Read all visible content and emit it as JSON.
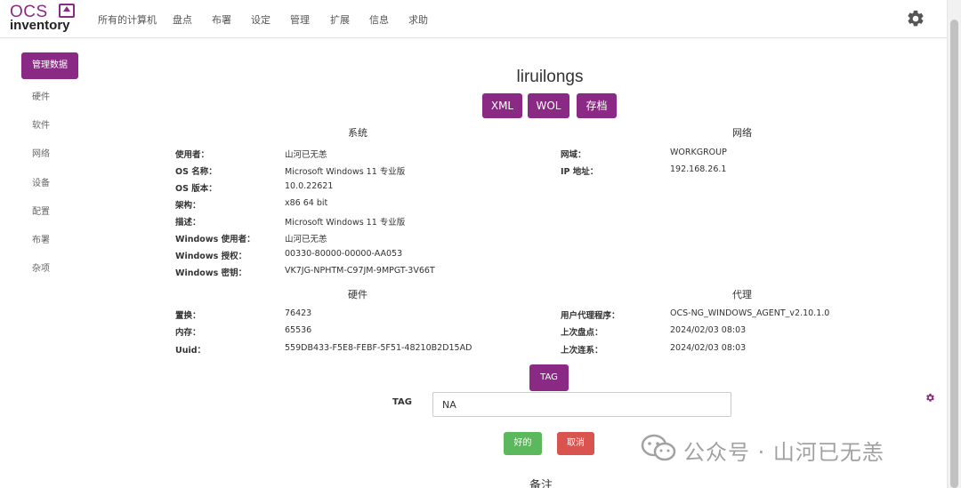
{
  "logo": {
    "top": "OCS",
    "bottom": "inventory"
  },
  "nav": [
    "所有的计算机",
    "盘点",
    "布署",
    "设定",
    "管理",
    "扩展",
    "信息",
    "求助"
  ],
  "icons": {
    "settings": "gear-icon",
    "tag_settings": "gear-icon",
    "watermark": "wechat-icon"
  },
  "sidebar": {
    "active": "管理数据",
    "items": [
      "硬件",
      "软件",
      "网络",
      "设备",
      "配置",
      "布署",
      "杂项"
    ]
  },
  "computer": {
    "name": "liruilongs"
  },
  "actions": {
    "xml": "XML",
    "wol": "WOL",
    "archive": "存档"
  },
  "system": {
    "title": "系统",
    "rows": [
      {
        "label": "使用者：",
        "value": "山河已无恙"
      },
      {
        "label": "OS 名称：",
        "value": "Microsoft Windows 11 专业版"
      },
      {
        "label": "OS 版本：",
        "value": "10.0.22621"
      },
      {
        "label": "架构：",
        "value": "x86 64 bit"
      },
      {
        "label": "描述：",
        "value": "Microsoft Windows 11 专业版"
      },
      {
        "label": "Windows 使用者：",
        "value": "山河已无恙"
      },
      {
        "label": "Windows 授权：",
        "value": "00330-80000-00000-AA053"
      },
      {
        "label": "Windows 密钥：",
        "value": "VK7JG-NPHTM-C97JM-9MPGT-3V66T"
      }
    ]
  },
  "network": {
    "title": "网络",
    "rows": [
      {
        "label": "网域：",
        "value": "WORKGROUP"
      },
      {
        "label": "IP 地址：",
        "value": "192.168.26.1"
      }
    ]
  },
  "hardware": {
    "title": "硬件",
    "rows": [
      {
        "label": "置换：",
        "value": "76423"
      },
      {
        "label": "内存：",
        "value": "65536"
      },
      {
        "label": "Uuid：",
        "value": "559DB433-F5E8-FEBF-5F51-48210B2D15AD"
      }
    ]
  },
  "agent": {
    "title": "代理",
    "rows": [
      {
        "label": "用户代理程序：",
        "value": "OCS-NG_WINDOWS_AGENT_v2.10.1.0"
      },
      {
        "label": "上次盘点：",
        "value": "2024/02/03 08:03"
      },
      {
        "label": "上次连系：",
        "value": "2024/02/03 08:03"
      }
    ]
  },
  "tag": {
    "button": "TAG",
    "label": "TAG",
    "value": "NA"
  },
  "form": {
    "ok": "好的",
    "cancel": "取消"
  },
  "notes": {
    "title": "备注"
  },
  "watermark": {
    "text": "公众号 · 山河已无恙"
  },
  "colors": {
    "brand": "#8b2a85",
    "ok": "#5cb85c",
    "cancel": "#d9534f"
  }
}
